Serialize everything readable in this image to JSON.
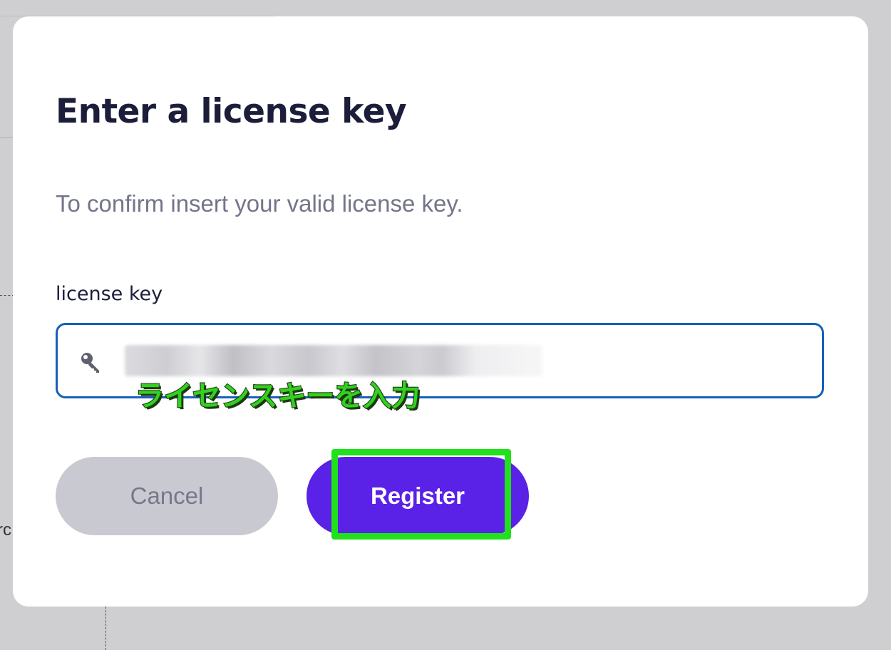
{
  "background": {
    "partial_text": "rc"
  },
  "modal": {
    "title": "Enter a license key",
    "description": "To confirm insert your valid license key.",
    "field_label": "license key",
    "input": {
      "value": "",
      "masked": true,
      "icon": "key-icon"
    },
    "annotation": "ライセンスキーを入力",
    "buttons": {
      "cancel": "Cancel",
      "register": "Register"
    }
  },
  "colors": {
    "primary": "#5a21e6",
    "input_border": "#1660b8",
    "cancel_bg": "#c9cad1",
    "highlight": "#21e01c",
    "title": "#1b1d3a"
  }
}
